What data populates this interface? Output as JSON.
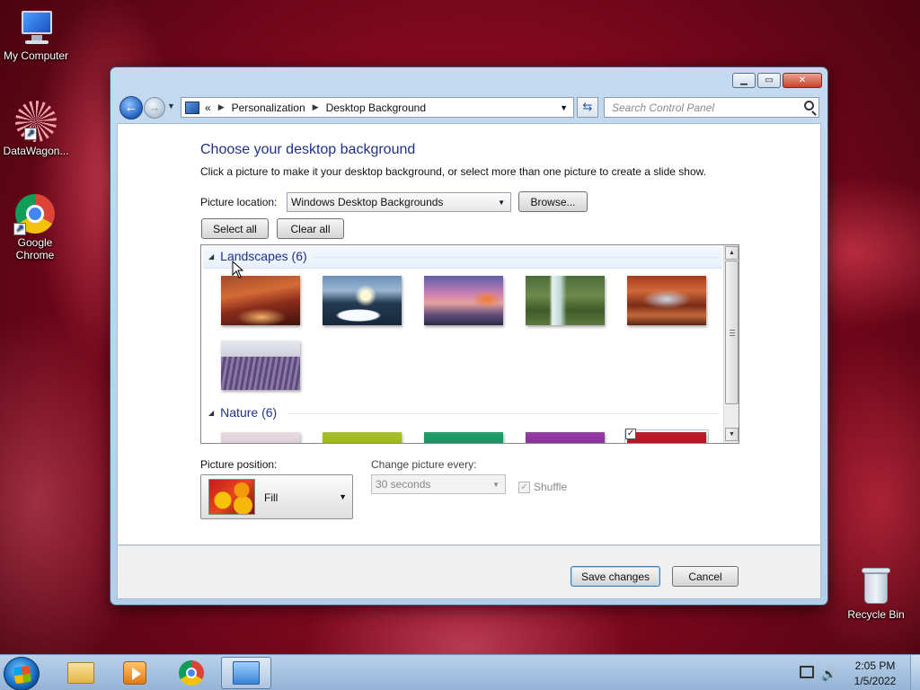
{
  "desktop": {
    "icons": [
      {
        "label": "My Computer"
      },
      {
        "label": "DataWagon..."
      },
      {
        "label": "Google\nChrome"
      },
      {
        "label": "Recycle Bin"
      }
    ]
  },
  "window": {
    "address": {
      "prefix": "«",
      "crumb1": "Personalization",
      "crumb2": "Desktop Background"
    },
    "search_placeholder": "Search Control Panel",
    "heading": "Choose your desktop background",
    "instructions": "Click a picture to make it your desktop background, or select more than one picture to create a slide show.",
    "picture_location_label": "Picture location:",
    "picture_location_value": "Windows Desktop Backgrounds",
    "browse_label": "Browse...",
    "select_all_label": "Select all",
    "clear_all_label": "Clear all",
    "groups": [
      {
        "title": "Landscapes (6)"
      },
      {
        "title": "Nature (6)"
      }
    ],
    "picture_position_label": "Picture position:",
    "picture_position_value": "Fill",
    "change_every_label": "Change picture every:",
    "change_every_value": "30 seconds",
    "shuffle_label": "Shuffle",
    "save_label": "Save changes",
    "cancel_label": "Cancel"
  },
  "taskbar": {
    "time": "2:05 PM",
    "date": "1/5/2022"
  }
}
